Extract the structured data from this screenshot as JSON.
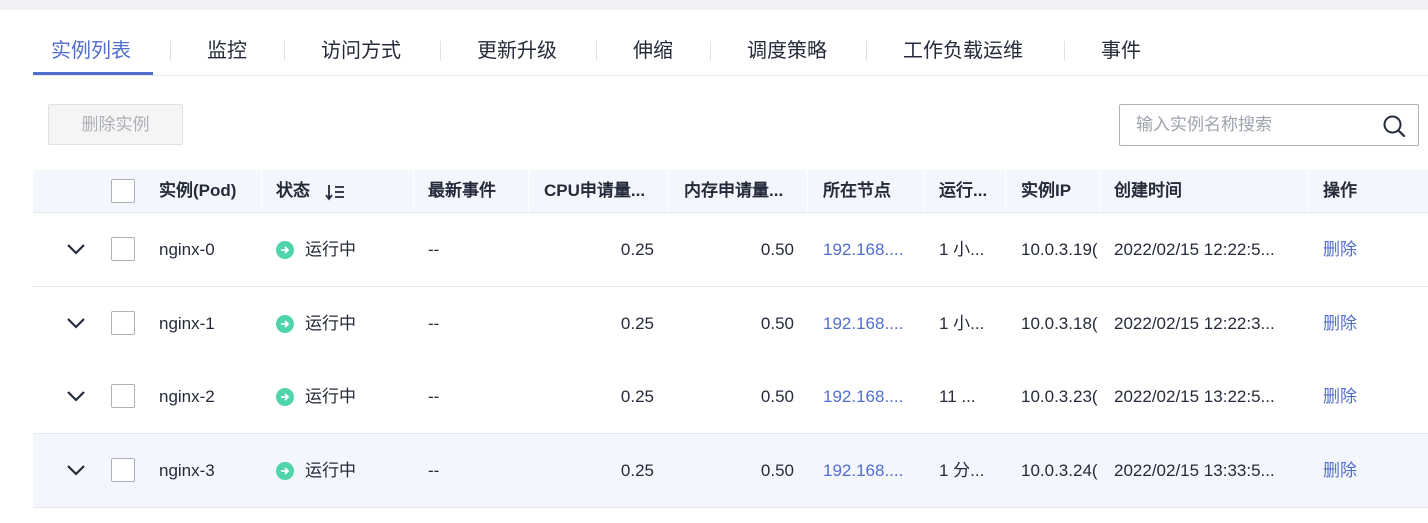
{
  "tabs": [
    {
      "label": "实例列表",
      "active": true
    },
    {
      "label": "监控"
    },
    {
      "label": "访问方式"
    },
    {
      "label": "更新升级"
    },
    {
      "label": "伸缩"
    },
    {
      "label": "调度策略"
    },
    {
      "label": "工作负载运维"
    },
    {
      "label": "事件"
    }
  ],
  "toolbar": {
    "delete_label": "删除实例",
    "search_placeholder": "输入实例名称搜索",
    "search_icon": "search-icon"
  },
  "table": {
    "headers": {
      "pod": "实例(Pod)",
      "status": "状态",
      "event": "最新事件",
      "cpu": "CPU申请量...",
      "mem": "内存申请量...",
      "node": "所在节点",
      "runtime": "运行...",
      "ip": "实例IP",
      "created": "创建时间",
      "action": "操作"
    },
    "rows": [
      {
        "name": "nginx-0",
        "status": "运行中",
        "event": "--",
        "cpu": "0.25",
        "mem": "0.50",
        "node": "192.168....",
        "runtime": "1 小...",
        "ip": "10.0.3.19(",
        "created": "2022/02/15 12:22:5...",
        "action": "删除"
      },
      {
        "name": "nginx-1",
        "status": "运行中",
        "event": "--",
        "cpu": "0.25",
        "mem": "0.50",
        "node": "192.168....",
        "runtime": "1 小...",
        "ip": "10.0.3.18(",
        "created": "2022/02/15 12:22:3...",
        "action": "删除"
      },
      {
        "name": "nginx-2",
        "status": "运行中",
        "event": "--",
        "cpu": "0.25",
        "mem": "0.50",
        "node": "192.168....",
        "runtime": "11 ...",
        "ip": "10.0.3.23(",
        "created": "2022/02/15 13:22:5...",
        "action": "删除"
      },
      {
        "name": "nginx-3",
        "status": "运行中",
        "event": "--",
        "cpu": "0.25",
        "mem": "0.50",
        "node": "192.168....",
        "runtime": "1 分...",
        "ip": "10.0.3.24(",
        "created": "2022/02/15 13:33:5...",
        "action": "删除"
      }
    ]
  },
  "colors": {
    "accent": "#526ecc",
    "status_running": "#50d4ab",
    "header_bg": "#f3f6fc"
  }
}
